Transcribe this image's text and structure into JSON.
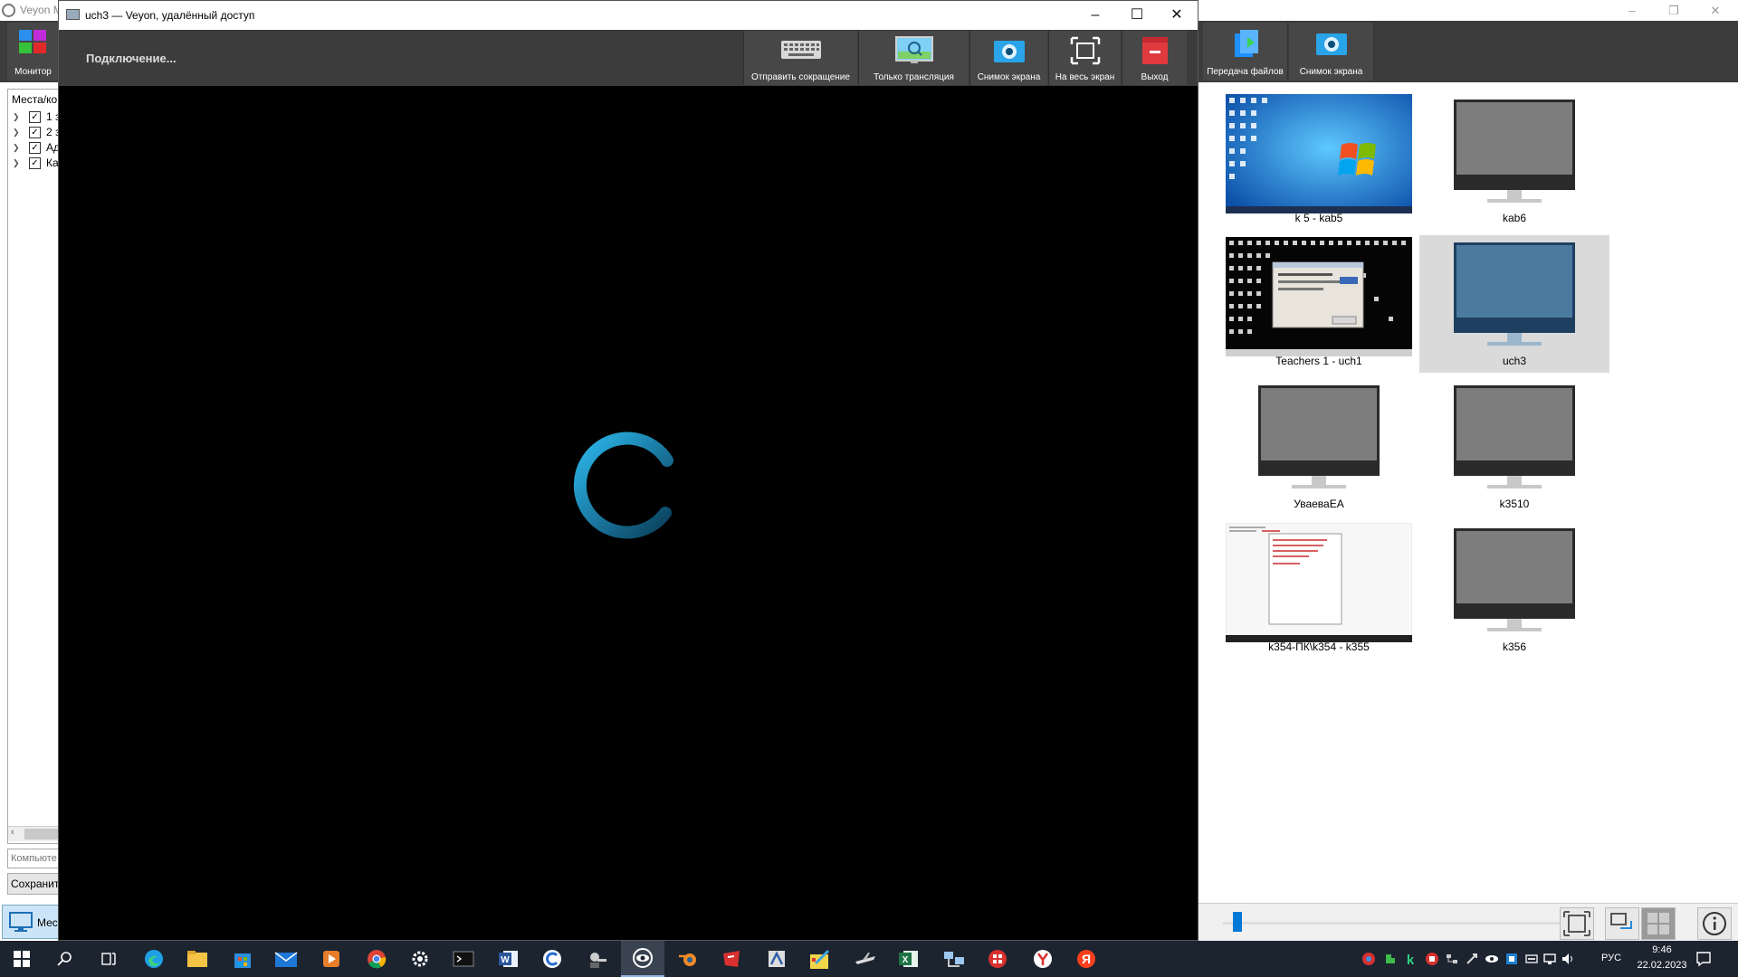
{
  "master": {
    "title": "Veyon M",
    "toolbar": {
      "monitor_label": "Монитор",
      "file_transfer_label": "Передача файлов",
      "screenshot_label": "Снимок экрана"
    },
    "places_header": "Места/ко",
    "tree": [
      {
        "label": "1 з",
        "checked": true
      },
      {
        "label": "2 з",
        "checked": true
      },
      {
        "label": "Ад",
        "checked": true
      },
      {
        "label": "Ка",
        "checked": true
      }
    ],
    "computer_search_placeholder": "Компьюте",
    "save_label": "Сохранить",
    "bottom_left_label": "Мес",
    "computers": [
      {
        "name": "k 5 - kab5",
        "state": "screen-win7"
      },
      {
        "name": "kab6",
        "state": "offline"
      },
      {
        "name": "Teachers 1 - uch1",
        "state": "screen-desktop"
      },
      {
        "name": "uch3",
        "state": "selected"
      },
      {
        "name": "УваеваЕА",
        "state": "offline"
      },
      {
        "name": "k3510",
        "state": "offline"
      },
      {
        "name": "k354-ПК\\k354 - k355",
        "state": "screen-document"
      },
      {
        "name": "k356",
        "state": "offline"
      }
    ],
    "zoom_level": 0.03
  },
  "remote": {
    "title": "uch3 — Veyon, удалённый доступ",
    "status": "Подключение...",
    "toolbar": {
      "send_shortcut": "Отправить сокращение",
      "view_only": "Только трансляция",
      "screenshot": "Снимок экрана",
      "fullscreen": "На весь экран",
      "exit": "Выход"
    }
  },
  "taskbar": {
    "apps": [
      "windows-start",
      "search",
      "task-view",
      "edge",
      "file-explorer",
      "store",
      "mail",
      "media-player",
      "chrome",
      "settings",
      "terminal",
      "word",
      "ccleaner",
      "keys-app",
      "veyon",
      "blender",
      "red-app",
      "archive-app",
      "paint-app",
      "flight-app",
      "excel",
      "network-app",
      "red-shield-app",
      "yandex-browser",
      "yandex"
    ],
    "active_app": "veyon",
    "language": "РУС",
    "time": "9:46",
    "date": "22.02.2023"
  },
  "colors": {
    "accent_blue": "#0078d7",
    "toolbar_dark": "#3c3c3c",
    "button_dark": "#474747",
    "spinner": "#1ea5d9"
  }
}
